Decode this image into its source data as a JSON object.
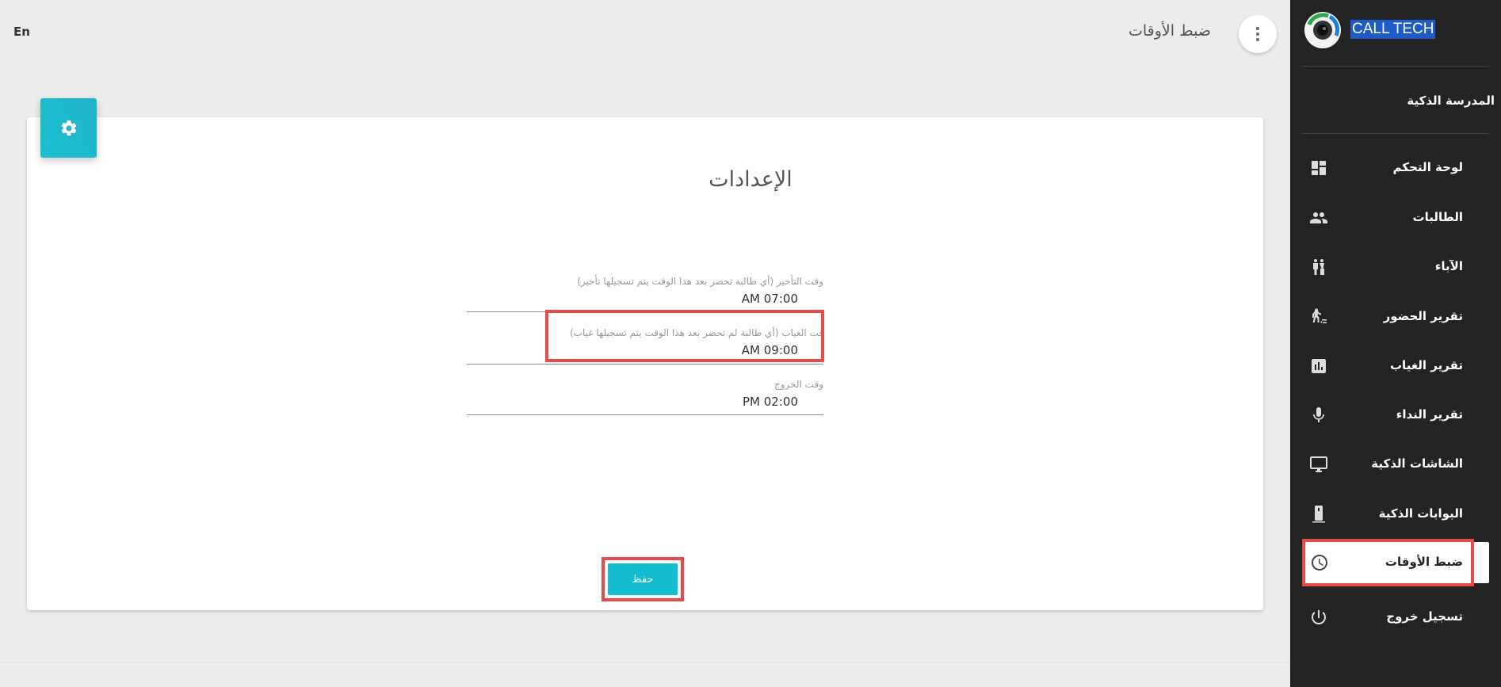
{
  "header": {
    "language_toggle": "En",
    "page_title": "ضبط الأوقات"
  },
  "card": {
    "title": "الإعدادات",
    "fields": [
      {
        "label": "وقت التأخير (أي طالبة تحضر بعد هذا الوقت يتم تسجيلها تأخير)",
        "value": "07:00 AM"
      },
      {
        "label": "قت الغياب (أي طالبة لم تحضر بعد هذا الوقت يتم تسجيلها غياب)",
        "value": "09:00 AM"
      },
      {
        "label": "وقت الخروج",
        "value": "02:00 PM"
      }
    ],
    "save_label": "حفظ"
  },
  "sidebar": {
    "brand": "CALL TECH",
    "school": "المدرسة الذكية",
    "items": [
      {
        "label": "لوحة التحكم",
        "icon": "dashboard-icon"
      },
      {
        "label": "الطالبات",
        "icon": "people-icon"
      },
      {
        "label": "الآباء",
        "icon": "parents-icon"
      },
      {
        "label": "تقرير الحضور",
        "icon": "walk-icon"
      },
      {
        "label": "تقرير الغياب",
        "icon": "bar-chart-icon"
      },
      {
        "label": "تقرير النداء",
        "icon": "mic-icon"
      },
      {
        "label": "الشاشات الذكية",
        "icon": "monitor-icon"
      },
      {
        "label": "البوابات الذكية",
        "icon": "gate-icon"
      },
      {
        "label": "ضبط الأوقات",
        "icon": "clock-icon",
        "active": true
      },
      {
        "label": "تسجيل خروج",
        "icon": "power-icon"
      }
    ]
  },
  "colors": {
    "accent": "#14bcd2",
    "sidebar_bg": "#232323",
    "highlight": "#e64a4a",
    "brand_highlight": "#1e5bc7"
  }
}
